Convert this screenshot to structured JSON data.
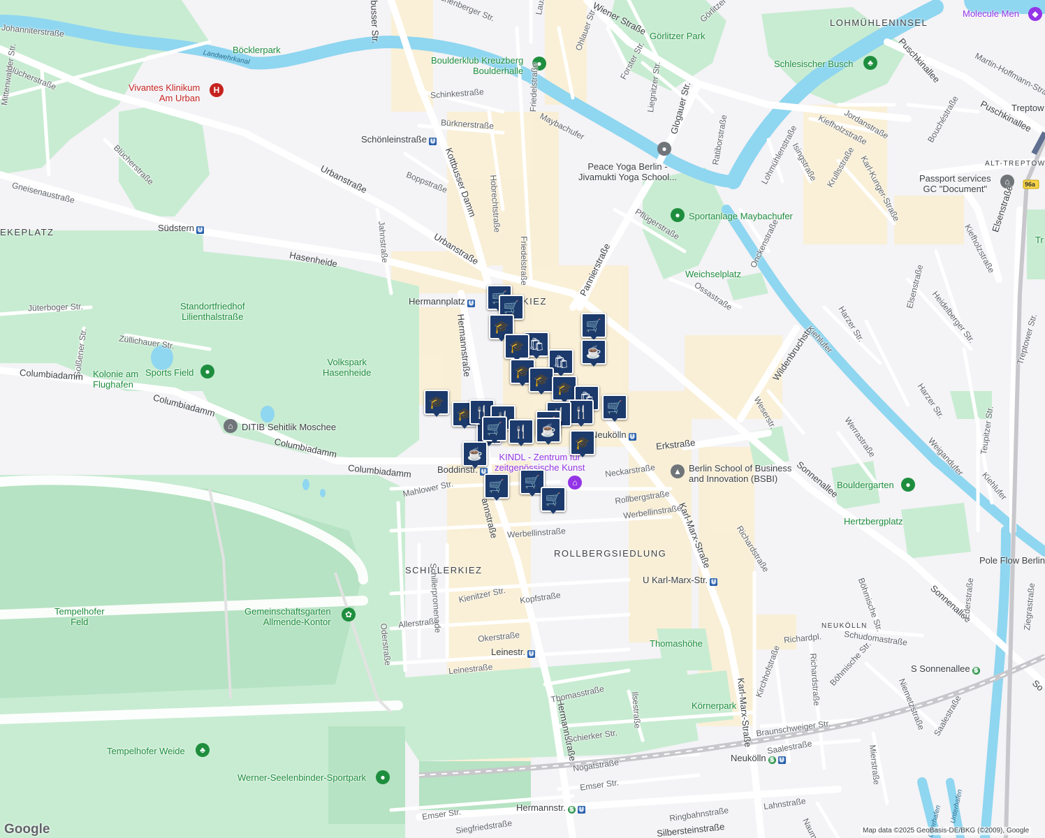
{
  "map": {
    "attribution": "Map data ©2025 GeoBasis-DE/BKG (©2009), Google",
    "logo": "Google",
    "highway_shield": "96a",
    "neighborhoods": [
      {
        "id": "lohmuehleninsel",
        "text": "LOHMÜHLENINSEL"
      },
      {
        "id": "reuterkiez",
        "text": "KIEZ"
      },
      {
        "id": "rollbergsiedlung",
        "text": "ROLLBERGSIEDLUNG"
      },
      {
        "id": "schillerkiez",
        "text": "SCHILLERKIEZ"
      },
      {
        "id": "neukoelln",
        "text": "NEUKÖLLN"
      },
      {
        "id": "alt-treptow",
        "text": "ALT-TREPTOW"
      },
      {
        "id": "kepplatz",
        "text": "EKEPLATZ"
      }
    ],
    "parks": [
      {
        "id": "goerlitzer-park",
        "text": "Görlitzer Park"
      },
      {
        "id": "boecklerpark",
        "text": "Böcklerpark"
      },
      {
        "id": "schlesischer-busch",
        "text": "Schlesischer Busch"
      },
      {
        "id": "weichselplatz",
        "text": "Weichselplatz"
      },
      {
        "id": "standortfriedhof",
        "text": "Standortfriedhof\nLilienthalstraße"
      },
      {
        "id": "volkspark",
        "text": "Volkspark\nHasenheide"
      },
      {
        "id": "kolonie",
        "text": "Kolonie am\nFlughafen"
      },
      {
        "id": "tempelhofer-feld",
        "text": "Tempelhofer\nFeld"
      },
      {
        "id": "allmende",
        "text": "Gemeinschaftsgarten\nAllmende-Kontor"
      },
      {
        "id": "tempelhofer-weide",
        "text": "Tempelhofer Weide"
      },
      {
        "id": "werner-seelenbinder",
        "text": "Werner-Seelenbinder-Sportpark"
      },
      {
        "id": "koernerpark",
        "text": "Körnerpark"
      },
      {
        "id": "thomashoehe",
        "text": "Thomashöhe"
      },
      {
        "id": "hertzbergplatz",
        "text": "Hertzbergplatz"
      },
      {
        "id": "bouldergarten",
        "text": "Bouldergarten"
      },
      {
        "id": "sportanlage",
        "text": "Sportanlage Maybachufer"
      },
      {
        "id": "sports-field",
        "text": "Sports Field"
      }
    ],
    "pois": [
      {
        "id": "molecule-men",
        "text": "Molecule Men"
      },
      {
        "id": "boulderklub",
        "text": "Boulderklub Kreuzberg\nBoulderhalle"
      },
      {
        "id": "vivantes",
        "text": "Vivantes Klinikum\nAm Urban"
      },
      {
        "id": "peace-yoga",
        "text": "Peace Yoga Berlin -\nJivamukti Yoga School..."
      },
      {
        "id": "passport",
        "text": "Passport services\nGC \"Document\""
      },
      {
        "id": "ditib",
        "text": "DITIB Sehitlik Moschee"
      },
      {
        "id": "bsbi",
        "text": "Berlin School of Business\nand Innovation (BSBI)"
      },
      {
        "id": "kindl",
        "text": "KINDL - Zentrum für\nzeitgenössische Kunst"
      },
      {
        "id": "pole-flow",
        "text": "Pole Flow Berlin"
      },
      {
        "id": "treptow-edge",
        "text": "Treptow"
      },
      {
        "id": "tr-edge",
        "text": "Tr"
      }
    ],
    "stations": [
      {
        "id": "schoenleinstrasse",
        "text": "Schönleinstraße",
        "type": "U"
      },
      {
        "id": "suedstern",
        "text": "Südstern",
        "type": "U"
      },
      {
        "id": "hermannplatz",
        "text": "Hermannplatz",
        "type": "U"
      },
      {
        "id": "boddinstr",
        "text": "Boddinstr.",
        "type": "U"
      },
      {
        "id": "rathaus-neukoelln",
        "text": "Neukölln",
        "type": "U"
      },
      {
        "id": "karl-marx-str",
        "text": "U Karl-Marx-Str.",
        "type": "U"
      },
      {
        "id": "leinestr",
        "text": "Leinestr.",
        "type": "U"
      },
      {
        "id": "neukoelln",
        "text": "Neukölln",
        "type": "SU"
      },
      {
        "id": "hermannstr",
        "text": "Hermannstr.",
        "type": "SU"
      },
      {
        "id": "sonnenallee",
        "text": "S Sonnenallee",
        "type": "S"
      }
    ],
    "streets": [
      {
        "id": "johanniterstrasse",
        "text": "Johanniterstraße"
      },
      {
        "id": "bluecherstrasse",
        "text": "Blücherstraße"
      },
      {
        "id": "mittenwalder",
        "text": "Mittenwalder Str."
      },
      {
        "id": "bluecherstrasse2",
        "text": "Blücherstraße"
      },
      {
        "id": "gneisenaustrasse",
        "text": "Gneisenaustraße"
      },
      {
        "id": "hasenheide",
        "text": "Hasenheide"
      },
      {
        "id": "jueterboger",
        "text": "Jüterboger Str."
      },
      {
        "id": "zuellichauer",
        "text": "Züllichauer Str."
      },
      {
        "id": "golssener",
        "text": "Golßener Str."
      },
      {
        "id": "columbiadamm1",
        "text": "Columbiadamm"
      },
      {
        "id": "columbiadamm2",
        "text": "Columbiadamm"
      },
      {
        "id": "columbiadamm3",
        "text": "Columbiadamm"
      },
      {
        "id": "columbiadamm4",
        "text": "Columbiadamm"
      },
      {
        "id": "jahnstrasse",
        "text": "Jahnstraße"
      },
      {
        "id": "urbanstrasse1",
        "text": "Urbanstraße"
      },
      {
        "id": "urbanstrasse2",
        "text": "Urbanstraße"
      },
      {
        "id": "boppstrasse",
        "text": "Boppstraße"
      },
      {
        "id": "kottbusser-damm",
        "text": "Kottbusser Damm"
      },
      {
        "id": "kottbusser-str",
        "text": "busser Str."
      },
      {
        "id": "schinkestrasse",
        "text": "Schinkestraße"
      },
      {
        "id": "buerknerstrasse",
        "text": "Bürknerstraße"
      },
      {
        "id": "hobrechtstrasse",
        "text": "Hobrechtstraße"
      },
      {
        "id": "friedelstrasse1",
        "text": "Friedelstraße"
      },
      {
        "id": "friedelstrasse2",
        "text": "Friedelstraße"
      },
      {
        "id": "maybachufer",
        "text": "Maybachufer"
      },
      {
        "id": "lausitzer",
        "text": "Lausitzer Str."
      },
      {
        "id": "reichenberger",
        "text": "ichenberger Str."
      },
      {
        "id": "ohlauer",
        "text": "Ohlauer Str."
      },
      {
        "id": "wiener",
        "text": "Wiener Straße"
      },
      {
        "id": "forster",
        "text": "Forster Str."
      },
      {
        "id": "goerlitzer-str",
        "text": "Görlitzer Str."
      },
      {
        "id": "liegnitzer",
        "text": "Liegnitzer Str."
      },
      {
        "id": "glogauer",
        "text": "Glogauer Str."
      },
      {
        "id": "ratiborstrasse",
        "text": "Ratiborstraße"
      },
      {
        "id": "pannierstrasse",
        "text": "Pannierstraße"
      },
      {
        "id": "pfluegerstrasse",
        "text": "Pflügerstraße"
      },
      {
        "id": "ossastrasse",
        "text": "Ossastraße"
      },
      {
        "id": "wildenbruchstr",
        "text": "Wildenbruchstr."
      },
      {
        "id": "kiehlufer1",
        "text": "Kiehlufer"
      },
      {
        "id": "kiehlufer2",
        "text": "Kiehlufer"
      },
      {
        "id": "weserstr",
        "text": "Weserstr."
      },
      {
        "id": "werrastrasse",
        "text": "Werrastraße"
      },
      {
        "id": "weigandufer",
        "text": "Weigandufer"
      },
      {
        "id": "sonnenallee1",
        "text": "Sonnenallee"
      },
      {
        "id": "sonnenallee2",
        "text": "Sonnenallee"
      },
      {
        "id": "sonnenallee3",
        "text": "So"
      },
      {
        "id": "hermannstrasse1",
        "text": "Hermannstraße"
      },
      {
        "id": "hermannstrasse2",
        "text": "annstraße"
      },
      {
        "id": "hermannstrasse3",
        "text": "Hermannstraße"
      },
      {
        "id": "erkstrasse",
        "text": "Erkstraße"
      },
      {
        "id": "neckarstrasse",
        "text": "Neckarstraße"
      },
      {
        "id": "rollbergstrasse",
        "text": "Rollbergstraße"
      },
      {
        "id": "werbellinstrasse1",
        "text": "Werbellinstraße"
      },
      {
        "id": "werbellinstrasse2",
        "text": "Werbellinstraße"
      },
      {
        "id": "mahlower",
        "text": "Mahlower Str."
      },
      {
        "id": "karl-marx-strasse1",
        "text": "Karl-Marx-Straße"
      },
      {
        "id": "karl-marx-strasse2",
        "text": "Karl-Marx-Straße"
      },
      {
        "id": "richardstrasse1",
        "text": "Richardstraße"
      },
      {
        "id": "richardstrasse2",
        "text": "Richardstraße"
      },
      {
        "id": "richardpl",
        "text": "Richardpl."
      },
      {
        "id": "kienitzer",
        "text": "Kienitzer Str."
      },
      {
        "id": "kopfstrasse",
        "text": "Kopfstraße"
      },
      {
        "id": "allerstrasse",
        "text": "Allerstraße"
      },
      {
        "id": "okerstrasse",
        "text": "Okerstraße"
      },
      {
        "id": "leinestrasse",
        "text": "Leinestraße"
      },
      {
        "id": "schillerpromenade",
        "text": "Schillerpromenade"
      },
      {
        "id": "oderstrasse",
        "text": "Oderstraße"
      },
      {
        "id": "thomasstrasse",
        "text": "Thomasstraße"
      },
      {
        "id": "ilsestrasse",
        "text": "Ilsestraße"
      },
      {
        "id": "schierker",
        "text": "Schierker Str."
      },
      {
        "id": "nogatstrasse",
        "text": "Nogatstraße"
      },
      {
        "id": "emser1",
        "text": "Emser Str."
      },
      {
        "id": "emser2",
        "text": "Emser Str."
      },
      {
        "id": "siegfriedstrasse",
        "text": "Siegfriedstraße"
      },
      {
        "id": "ringbahnstrasse",
        "text": "Ringbahnstraße"
      },
      {
        "id": "lahnstrasse",
        "text": "Lahnstraße"
      },
      {
        "id": "silbersteinstrasse",
        "text": "Silbersteinstraße"
      },
      {
        "id": "saalestrasse1",
        "text": "Saalestraße"
      },
      {
        "id": "saalestrasse2",
        "text": "Saalestraße"
      },
      {
        "id": "braunschweiger",
        "text": "Braunschweiger Str."
      },
      {
        "id": "kirchhofstrasse",
        "text": "Kirchhofstraße"
      },
      {
        "id": "boehmische1",
        "text": "Böhmische Str."
      },
      {
        "id": "boehmische2",
        "text": "Böhmische Str."
      },
      {
        "id": "schudomastrasse",
        "text": "Schudomastraße"
      },
      {
        "id": "niemetzstrasse",
        "text": "Niemetzstraße"
      },
      {
        "id": "mierstrasse",
        "text": "Mierstraße"
      },
      {
        "id": "naumburger",
        "text": "Naumburger"
      },
      {
        "id": "ederstrasse",
        "text": "Ederstraße"
      },
      {
        "id": "ziegrastrasse",
        "text": "Ziegrastraße"
      },
      {
        "id": "harzer1",
        "text": "Harzer Str."
      },
      {
        "id": "harzer2",
        "text": "Harzer Str."
      },
      {
        "id": "elsenstrasse1",
        "text": "Elsenstraße"
      },
      {
        "id": "elsenstrasse2",
        "text": "Elsenstraße"
      },
      {
        "id": "heidelberger",
        "text": "Heidelberger Str."
      },
      {
        "id": "teupitzer",
        "text": "Teupitzer Str."
      },
      {
        "id": "treptower",
        "text": "Treptower Str."
      },
      {
        "id": "kiefholzstrasse1",
        "text": "Kiefholzstraße"
      },
      {
        "id": "kiefholzstrasse2",
        "text": "Kiefholzstraße"
      },
      {
        "id": "karl-kunger",
        "text": "Karl-Kunger-Straße"
      },
      {
        "id": "krullsstrasse",
        "text": "Krullsstraße"
      },
      {
        "id": "isingstrasse",
        "text": "Isingstraße"
      },
      {
        "id": "lohmuehlenstrasse",
        "text": "Lohmühlenstraße"
      },
      {
        "id": "jordanstrasse",
        "text": "Jordanstraße"
      },
      {
        "id": "bouchestrasse",
        "text": "Bouchéstraße"
      },
      {
        "id": "puschkinallee1",
        "text": "Puschkinallee"
      },
      {
        "id": "puschkinallee2",
        "text": "Puschkinallee"
      },
      {
        "id": "martin-hoffmann",
        "text": "Martin-Hoffmann-Stra"
      },
      {
        "id": "onckenstrasse",
        "text": "Onckenstraße"
      },
      {
        "id": "landwehrkanal",
        "text": "Landwehrkanal"
      },
      {
        "id": "unterhafen",
        "text": "Unterhafen"
      },
      {
        "id": "oberhafen",
        "text": "Oberhafen"
      }
    ],
    "markers": [
      {
        "icon": "shopping-cart-icon",
        "glyph": "🛒"
      },
      {
        "icon": "shopping-cart-icon",
        "glyph": "🛒"
      },
      {
        "icon": "school-icon",
        "glyph": "🎓"
      },
      {
        "icon": "shopping-bag-icon",
        "glyph": "🛍"
      },
      {
        "icon": "school-icon",
        "glyph": "🎓"
      },
      {
        "icon": "shopping-cart-icon",
        "glyph": "🛒"
      },
      {
        "icon": "cafe-icon",
        "glyph": "☕"
      },
      {
        "icon": "shopping-bag-icon",
        "glyph": "🛍"
      },
      {
        "icon": "school-icon",
        "glyph": "🎓"
      },
      {
        "icon": "school-icon",
        "glyph": "🎓"
      },
      {
        "icon": "school-icon",
        "glyph": "🎓"
      },
      {
        "icon": "shopping-bag-icon",
        "glyph": "🛍"
      },
      {
        "icon": "school-icon",
        "glyph": "🎓"
      },
      {
        "icon": "shopping-cart-icon",
        "glyph": "🛒"
      },
      {
        "icon": "school-icon",
        "glyph": "🎓"
      },
      {
        "icon": "shopping-cart-icon",
        "glyph": "🛒"
      },
      {
        "icon": "restaurant-icon",
        "glyph": "🍴"
      },
      {
        "icon": "restaurant-icon",
        "glyph": "🍴"
      },
      {
        "icon": "restaurant-icon",
        "glyph": "🍴"
      },
      {
        "icon": "shopping-cart-icon",
        "glyph": "🛒"
      },
      {
        "icon": "restaurant-icon",
        "glyph": "🍴"
      },
      {
        "icon": "restaurant-icon",
        "glyph": "🍴"
      },
      {
        "icon": "cafe-icon",
        "glyph": "☕"
      },
      {
        "icon": "shopping-cart-icon",
        "glyph": "🛒"
      },
      {
        "icon": "school-icon",
        "glyph": "🎓"
      },
      {
        "icon": "cafe-icon",
        "glyph": "☕"
      },
      {
        "icon": "shopping-cart-icon",
        "glyph": "🛒"
      },
      {
        "icon": "shopping-cart-icon",
        "glyph": "🛒"
      },
      {
        "icon": "shopping-cart-icon",
        "glyph": "🛒"
      }
    ],
    "colors": {
      "background": "#f4f3f6",
      "park": "#c8ecd2",
      "park_dark": "#a8dcb5",
      "water": "#8fd6f0",
      "road": "#ffffff",
      "road_edge": "#d6d6dc",
      "shopping_area": "#fbefcf",
      "marker": "#1c3a6b",
      "ubahn": "#1a56a8",
      "sbahn": "#1e8e3e"
    }
  }
}
